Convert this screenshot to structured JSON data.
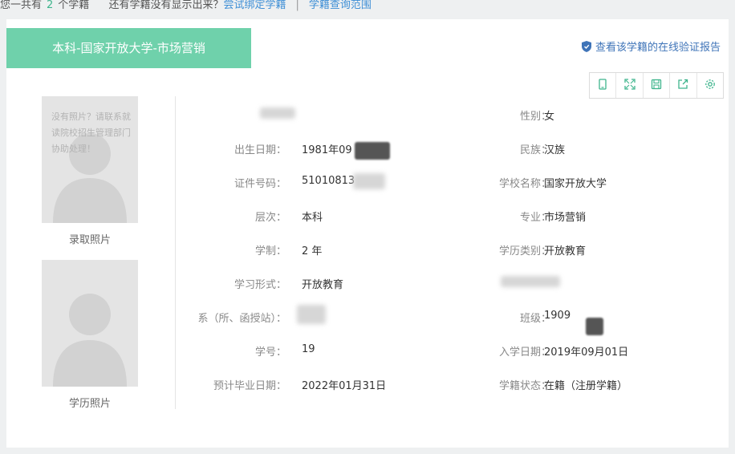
{
  "topbar": {
    "prefix": "您一共有",
    "count": "2",
    "suffix": "个学籍",
    "question": "还有学籍没有显示出来？",
    "bind_link": "尝试绑定学籍",
    "separator": "|",
    "scope_link": "学籍查询范围"
  },
  "record_tab": {
    "title": "本科-国家开放大学-市场营销"
  },
  "verify_link": {
    "label": "查看该学籍的在线验证报告"
  },
  "toolbar": {
    "icons": [
      "phone-icon",
      "fullscreen-icon",
      "save-icon",
      "share-icon",
      "settings-icon"
    ]
  },
  "photos": {
    "admission": {
      "label": "录取照片",
      "note": "没有照片？请联系就读院校招生管理部门协助处理！"
    },
    "diploma": {
      "label": "学历照片"
    }
  },
  "fields": {
    "name": {
      "label": "",
      "value": ""
    },
    "gender": {
      "label": "性别：",
      "value": "女"
    },
    "birth_date": {
      "label": "出生日期：",
      "value": "1981年09"
    },
    "ethnicity": {
      "label": "民族：",
      "value": "汉族"
    },
    "id_number": {
      "label": "证件号码：",
      "value": "51010813"
    },
    "school_name": {
      "label": "学校名称：",
      "value": "国家开放大学"
    },
    "level": {
      "label": "层次：",
      "value": "本科"
    },
    "major": {
      "label": "专业：",
      "value": "市场营销"
    },
    "duration": {
      "label": "学制：",
      "value": "2 年"
    },
    "education_type": {
      "label": "学历类别：",
      "value": "开放教育"
    },
    "study_form": {
      "label": "学习形式：",
      "value": "开放教育"
    },
    "branch": {
      "label": "",
      "value": ""
    },
    "department": {
      "label": "系（所、函授站）：",
      "value": ""
    },
    "class": {
      "label": "班级：",
      "value": "1909"
    },
    "student_id": {
      "label": "学号：",
      "value": "19"
    },
    "enroll_date": {
      "label": "入学日期：",
      "value": "2019年09月01日"
    },
    "expected_graduation": {
      "label": "预计毕业日期：",
      "value": "2022年01月31日"
    },
    "status": {
      "label": "学籍状态：",
      "value": "在籍（注册学籍）"
    }
  },
  "colors": {
    "accent": "#6fd1ab",
    "link": "#3f8fd6",
    "count": "#3fb58d"
  }
}
